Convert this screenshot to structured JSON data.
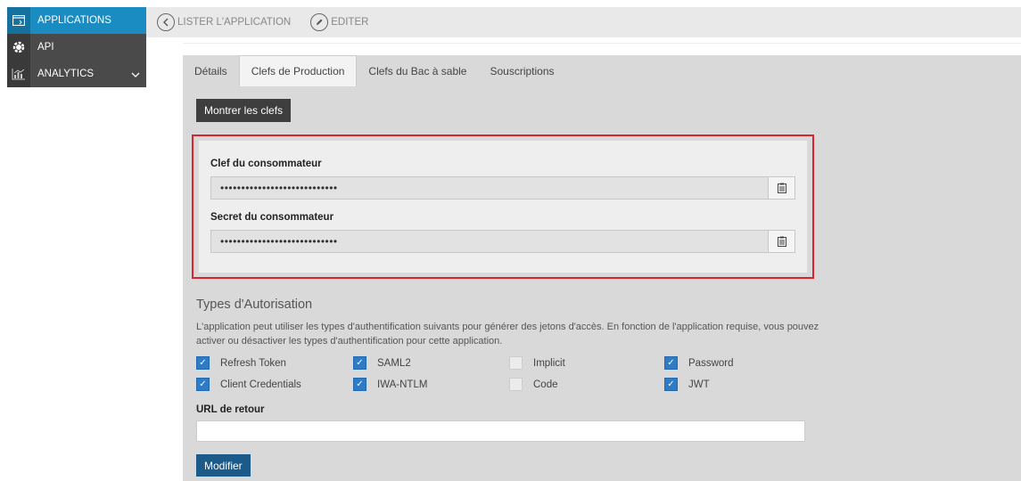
{
  "sidebar": {
    "items": [
      {
        "label": "APPLICATIONS",
        "icon": "window-icon"
      },
      {
        "label": "API",
        "icon": "api-gear-icon"
      },
      {
        "label": "ANALYTICS",
        "icon": "chart-icon"
      }
    ]
  },
  "toolbar": {
    "list_label": "LISTER L'APPLICATION",
    "edit_label": "EDITER"
  },
  "tabs": [
    {
      "label": "Détails"
    },
    {
      "label": "Clefs de Production",
      "active": true
    },
    {
      "label": "Clefs du Bac à sable"
    },
    {
      "label": "Souscriptions"
    }
  ],
  "show_keys_label": "Montrer les clefs",
  "keys": {
    "consumer_key_label": "Clef du consommateur",
    "consumer_key_value": "••••••••••••••••••••••••••••",
    "consumer_secret_label": "Secret du consommateur",
    "consumer_secret_value": "••••••••••••••••••••••••••••"
  },
  "grant_types": {
    "title": "Types d'Autorisation",
    "description": "L'application peut utiliser les types d'authentification suivants pour générer des jetons d'accès. En fonction de l'application requise, vous pouvez activer ou désactiver les types d'authentification pour cette application.",
    "options": [
      {
        "label": "Refresh Token",
        "checked": true
      },
      {
        "label": "SAML2",
        "checked": true
      },
      {
        "label": "Implicit",
        "checked": false
      },
      {
        "label": "Password",
        "checked": true
      },
      {
        "label": "Client Credentials",
        "checked": true
      },
      {
        "label": "IWA-NTLM",
        "checked": true
      },
      {
        "label": "Code",
        "checked": false
      },
      {
        "label": "JWT",
        "checked": true
      }
    ]
  },
  "callback": {
    "label": "URL de retour",
    "value": ""
  },
  "modify_label": "Modifier",
  "colors": {
    "accent": "#1a8cc2",
    "highlight_border": "#d9232e",
    "checkbox_on": "#2e7cc8",
    "modify_button": "#1c5a8a"
  }
}
